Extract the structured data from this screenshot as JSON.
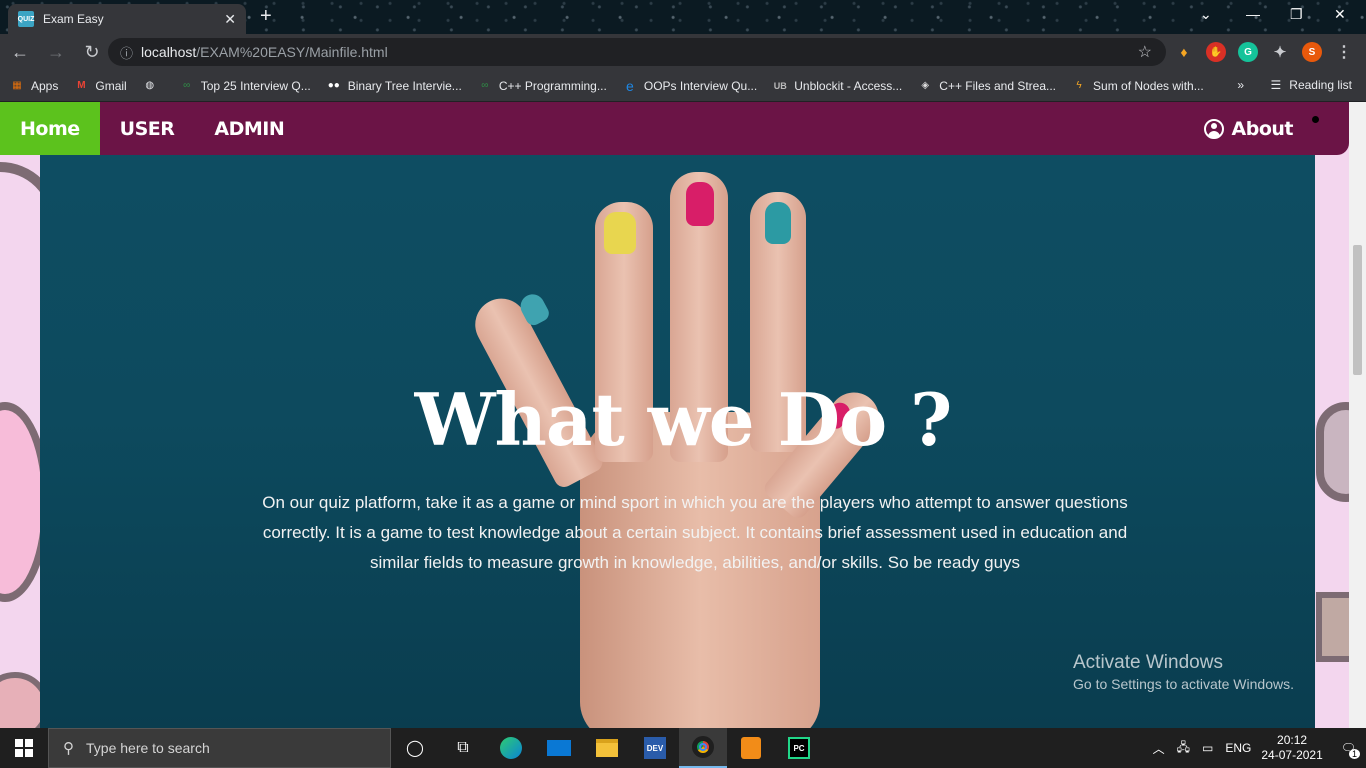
{
  "browser": {
    "tab_title": "Exam Easy",
    "tab_favicon_text": "QUIZ",
    "url_host": "localhost",
    "url_path": "/EXAM%20EASY/Mainfile.html",
    "bookmarks": [
      {
        "label": "Apps",
        "icon": "apps-grid-icon"
      },
      {
        "label": "Gmail",
        "icon": "gmail-icon"
      },
      {
        "label": "",
        "icon": "globe-icon"
      },
      {
        "label": "Top 25 Interview Q...",
        "icon": "gfg-icon"
      },
      {
        "label": "Binary Tree Intervie...",
        "icon": "medium-icon"
      },
      {
        "label": "C++ Programming...",
        "icon": "gfg-icon"
      },
      {
        "label": "OOPs Interview Qu...",
        "icon": "edureka-icon"
      },
      {
        "label": "Unblockit - Access...",
        "icon": "unblockit-icon"
      },
      {
        "label": "C++ Files and Strea...",
        "icon": "tutorialspoint-icon"
      },
      {
        "label": "Sum of Nodes with...",
        "icon": "bolt-icon"
      }
    ],
    "reading_list": "Reading list",
    "profile_initial": "S"
  },
  "site": {
    "nav": {
      "home": "Home",
      "user": "USER",
      "admin": "ADMIN",
      "about": "About"
    },
    "headline": "What we Do ?",
    "paragraph": "On our quiz platform, take it as a game or mind sport in which you are the players who attempt to answer questions correctly. It is a game to test knowledge about a certain subject. It contains brief assessment used in education and similar fields to measure growth in knowledge, abilities, and/or skills. So be ready guys"
  },
  "watermark": {
    "line1": "Activate Windows",
    "line2": "Go to Settings to activate Windows."
  },
  "taskbar": {
    "search_placeholder": "Type here to search",
    "language": "ENG",
    "time": "20:12",
    "date": "24-07-2021",
    "notification_count": "1"
  },
  "colors": {
    "navbar": "#6b1446",
    "home_active": "#5cc21d",
    "hero": "#0e4e63"
  }
}
